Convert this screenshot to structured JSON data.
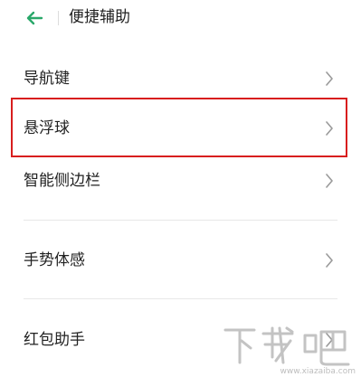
{
  "header": {
    "title": "便捷辅助",
    "back_icon": "back-arrow-icon",
    "back_color": "#2aa86a"
  },
  "items": [
    {
      "label": "导航键",
      "icon": "chevron-right-icon"
    },
    {
      "label": "悬浮球",
      "icon": "chevron-right-icon",
      "highlighted": true
    },
    {
      "label": "智能侧边栏",
      "icon": "chevron-right-icon"
    },
    {
      "label": "手势体感",
      "icon": "chevron-right-icon"
    },
    {
      "label": "红包助手",
      "icon": "chevron-right-icon"
    }
  ],
  "highlight_color": "#d81e1e",
  "watermark": {
    "brand": "下载吧",
    "url": "www.xiazaiba.com"
  }
}
